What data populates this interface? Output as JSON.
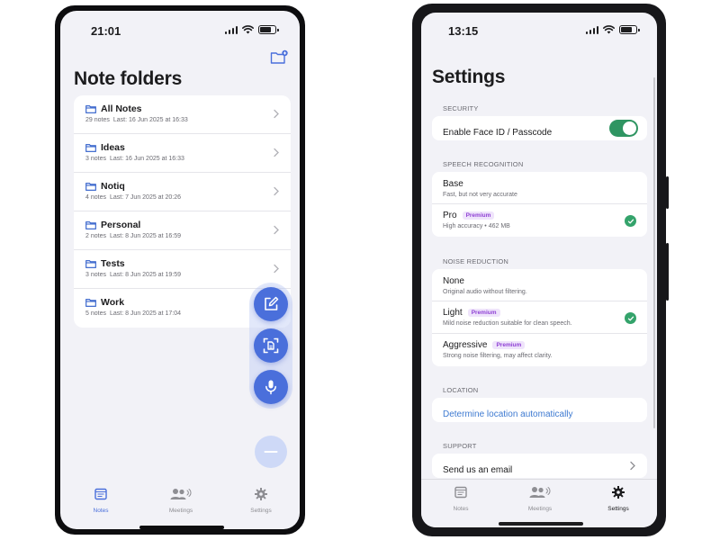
{
  "left_phone": {
    "status_bar": {
      "time": "21:01"
    },
    "title": "Note folders",
    "folders": [
      {
        "name": "All Notes",
        "count": "29 notes",
        "last": "Last: 16 Jun 2025 at 16:33"
      },
      {
        "name": "Ideas",
        "count": "3 notes",
        "last": "Last: 16 Jun 2025 at 16:33"
      },
      {
        "name": "Notiq",
        "count": "4 notes",
        "last": "Last: 7 Jun 2025 at 20:26"
      },
      {
        "name": "Personal",
        "count": "2 notes",
        "last": "Last: 8 Jun 2025 at 16:59"
      },
      {
        "name": "Tests",
        "count": "3 notes",
        "last": "Last: 8 Jun 2025 at 19:59"
      },
      {
        "name": "Work",
        "count": "5 notes",
        "last": "Last: 8 Jun 2025 at 17:04"
      }
    ],
    "tabs": [
      {
        "label": "Notes",
        "active": true
      },
      {
        "label": "Meetings",
        "active": false
      },
      {
        "label": "Settings",
        "active": false
      }
    ]
  },
  "right_phone": {
    "status_bar": {
      "time": "13:15"
    },
    "title": "Settings",
    "sections": {
      "security": {
        "header": "SECURITY",
        "face_id_label": "Enable Face ID / Passcode",
        "face_id_enabled": true
      },
      "speech": {
        "header": "SPEECH RECOGNITION",
        "options": [
          {
            "title": "Base",
            "desc": "Fast, but not very accurate",
            "premium": "",
            "selected": false
          },
          {
            "title": "Pro",
            "desc": "High accuracy • 462 MB",
            "premium": "Premium",
            "selected": true
          }
        ]
      },
      "noise": {
        "header": "NOISE REDUCTION",
        "options": [
          {
            "title": "None",
            "desc": "Original audio without filtering.",
            "premium": "",
            "selected": false
          },
          {
            "title": "Light",
            "desc": "Mild noise reduction suitable for clean speech.",
            "premium": "Premium",
            "selected": true
          },
          {
            "title": "Aggressive",
            "desc": "Strong noise filtering, may affect clarity.",
            "premium": "Premium",
            "selected": false
          }
        ]
      },
      "location": {
        "header": "LOCATION",
        "link_label": "Determine location automatically"
      },
      "support": {
        "header": "SUPPORT",
        "email_label": "Send us an email"
      }
    },
    "tabs": [
      {
        "label": "Notes",
        "active": false
      },
      {
        "label": "Meetings",
        "active": false
      },
      {
        "label": "Settings",
        "active": true
      }
    ]
  },
  "colors": {
    "accent_blue": "#4a6fdb",
    "toggle_green": "#2f9562",
    "check_green": "#34a36b",
    "premium_purple": "#8e3fd4",
    "link_blue": "#3e7ad1"
  }
}
